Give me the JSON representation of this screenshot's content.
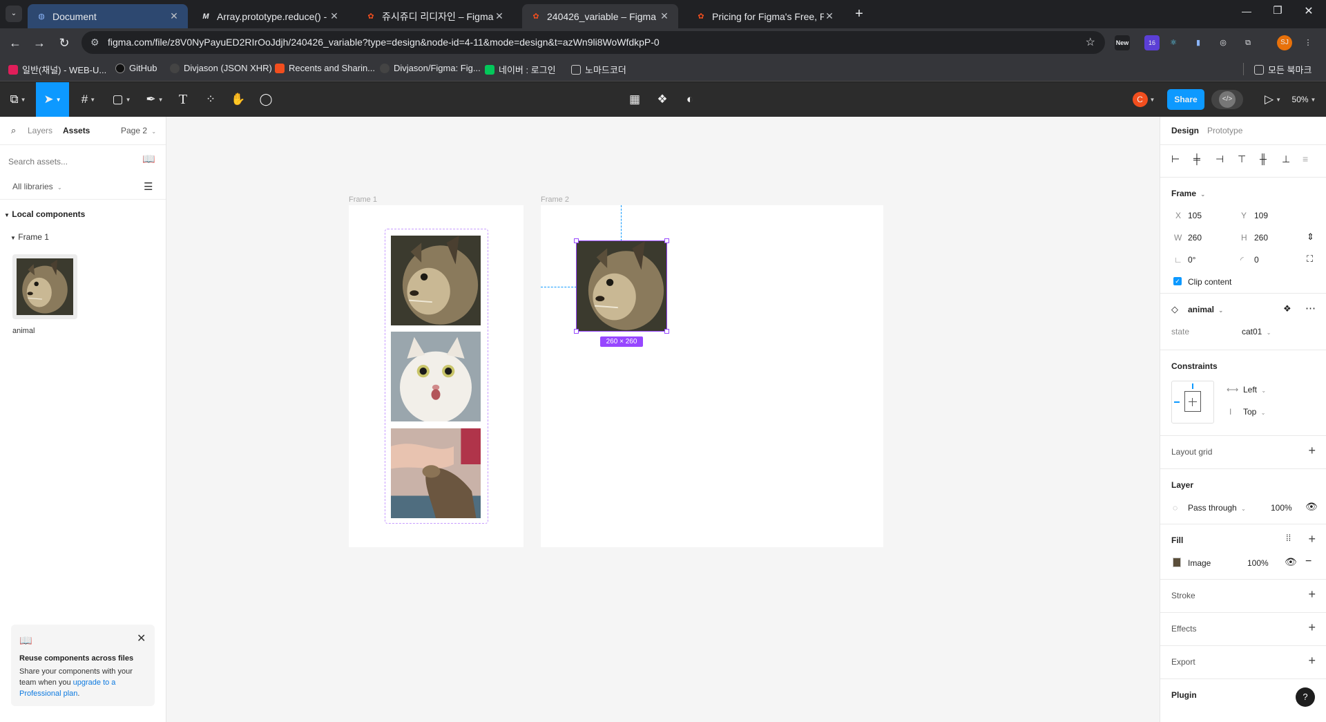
{
  "browser": {
    "tabs": [
      {
        "title": "Document",
        "favicon": "globe-icon"
      },
      {
        "title": "Array.prototype.reduce() - JavaScript",
        "favicon": "mdn-icon"
      },
      {
        "title": "쥬시쥬디 리디자인 – Figma",
        "favicon": "figma-icon"
      },
      {
        "title": "240426_variable – Figma",
        "favicon": "figma-icon"
      },
      {
        "title": "Pricing for Figma's Free, Professional",
        "favicon": "figma-icon"
      }
    ],
    "url": "figma.com/file/z8V0NyPayuED2RIrOoJdjh/240426_variable?type=design&node-id=4-11&mode=design&t=azWn9li8WoWfdkpP-0",
    "extensions": {
      "new_badge": "New",
      "count_badge": "16",
      "profile": "SJ"
    },
    "bookmarks": [
      {
        "label": "일반(채널) - WEB-U...",
        "color": "#e01e5a"
      },
      {
        "label": "GitHub",
        "color": "#111111"
      },
      {
        "label": "Divjason (JSON XHR)",
        "color": "#444444"
      },
      {
        "label": "Recents and Sharin...",
        "color": "#f24e1e"
      },
      {
        "label": "Divjason/Figma: Fig...",
        "color": "#444444"
      },
      {
        "label": "네이버 : 로그인",
        "color": "#03c75a"
      },
      {
        "label": "노마드코더",
        "color": "#888888"
      }
    ],
    "all_bookmarks": "모든 북마크"
  },
  "figma": {
    "toolbar": {
      "avatar": "C",
      "share": "Share",
      "zoom": "50%"
    },
    "left": {
      "tab_layers": "Layers",
      "tab_assets": "Assets",
      "page": "Page 2",
      "search_placeholder": "Search assets...",
      "libraries": "All libraries",
      "local_components": "Local components",
      "group": "Frame 1",
      "component_name": "animal",
      "promo_title": "Reuse components across files",
      "promo_text": "Share your components with your team when you ",
      "promo_link": "upgrade to a Professional plan",
      "promo_end": "."
    },
    "canvas": {
      "frame1_label": "Frame 1",
      "frame2_label": "Frame 2",
      "size_badge": "260 × 260"
    },
    "right": {
      "tab_design": "Design",
      "tab_prototype": "Prototype",
      "frame_title": "Frame",
      "x_label": "X",
      "x": "105",
      "y_label": "Y",
      "y": "109",
      "w_label": "W",
      "w": "260",
      "h_label": "H",
      "h": "260",
      "rotation": "0°",
      "radius": "0",
      "clip_content": "Clip content",
      "component": "animal",
      "prop_name": "state",
      "prop_value": "cat01",
      "constraints": "Constraints",
      "constraint_h": "Left",
      "constraint_v": "Top",
      "layout_grid": "Layout grid",
      "layer": "Layer",
      "blend": "Pass through",
      "layer_opacity": "100%",
      "fill": "Fill",
      "fill_type": "Image",
      "fill_opacity": "100%",
      "stroke": "Stroke",
      "effects": "Effects",
      "export": "Export",
      "plugin": "Plugin",
      "help": "?"
    }
  },
  "colors": {
    "accent": "#0d99ff",
    "selection": "#9747ff"
  }
}
